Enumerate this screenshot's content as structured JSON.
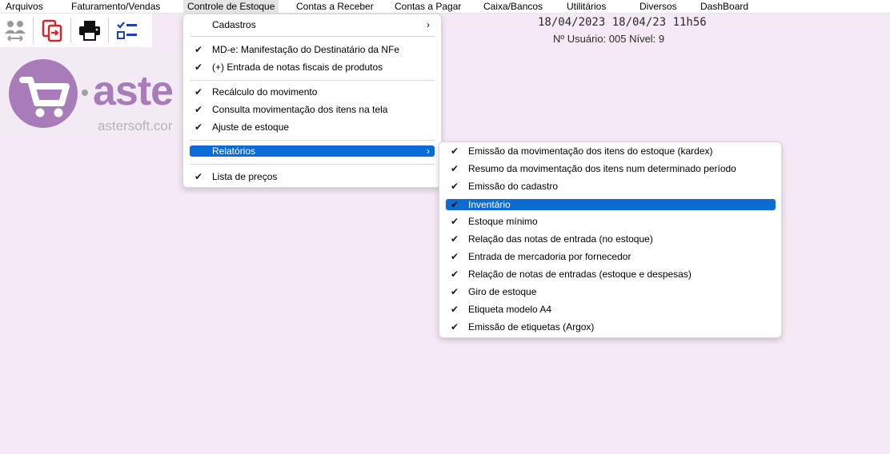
{
  "menubar": {
    "items": [
      {
        "label": "Arquivos"
      },
      {
        "label": "Faturamento/Vendas"
      },
      {
        "label": "Controle de Estoque"
      },
      {
        "label": "Contas a Receber"
      },
      {
        "label": "Contas a Pagar"
      },
      {
        "label": "Caixa/Bancos"
      },
      {
        "label": "Utilitários"
      },
      {
        "label": "Diversos"
      },
      {
        "label": "DashBoard"
      }
    ]
  },
  "toolbar": {
    "icons": [
      "users-transfer-icon",
      "copy-export-icon",
      "printer-icon",
      "checklist-icon"
    ]
  },
  "status": {
    "datetime": "18/04/2023  18/04/23 11h56",
    "user": "Nº Usuário: 005  Nível: 9"
  },
  "logo": {
    "word": "aste",
    "url": "astersoft.cor"
  },
  "estoque_menu": {
    "items": [
      {
        "label": "Cadastros",
        "submenu": true
      },
      {
        "label": "MD-e: Manifestação do Destinatário da NFe",
        "checked": true
      },
      {
        "label": "(+) Entrada de notas fiscais de produtos",
        "checked": true
      },
      {
        "label": "Recálculo do movimento",
        "checked": true
      },
      {
        "label": "Consulta movimentação dos itens na tela",
        "checked": true
      },
      {
        "label": "Ajuste de estoque",
        "checked": true
      },
      {
        "label": "Relatórios",
        "submenu": true,
        "highlighted": true
      },
      {
        "label": "Lista de preços",
        "checked": true
      }
    ]
  },
  "relatorios_menu": {
    "items": [
      {
        "label": "Emissão da movimentação dos itens do estoque (kardex)",
        "checked": true
      },
      {
        "label": "Resumo da movimentação dos itens num determinado período",
        "checked": true
      },
      {
        "label": "Emissão do cadastro",
        "checked": true
      },
      {
        "label": "Inventário",
        "checked": true,
        "highlighted": true
      },
      {
        "label": "Estoque mínimo",
        "checked": true
      },
      {
        "label": "Relação das notas de entrada (no estoque)",
        "checked": true
      },
      {
        "label": "Entrada de mercadoria por fornecedor",
        "checked": true
      },
      {
        "label": "Relação de notas de entradas (estoque e despesas)",
        "checked": true
      },
      {
        "label": "Giro de estoque",
        "checked": true
      },
      {
        "label": "Etiqueta modelo A4",
        "checked": true
      },
      {
        "label": "Emissão de etiquetas (Argox)",
        "checked": true
      }
    ]
  },
  "glyphs": {
    "check": "✔",
    "arrow": "›"
  },
  "colors": {
    "background": "#f6e9f6",
    "highlight": "#0a6cd4",
    "brand": "#a87cb8"
  }
}
